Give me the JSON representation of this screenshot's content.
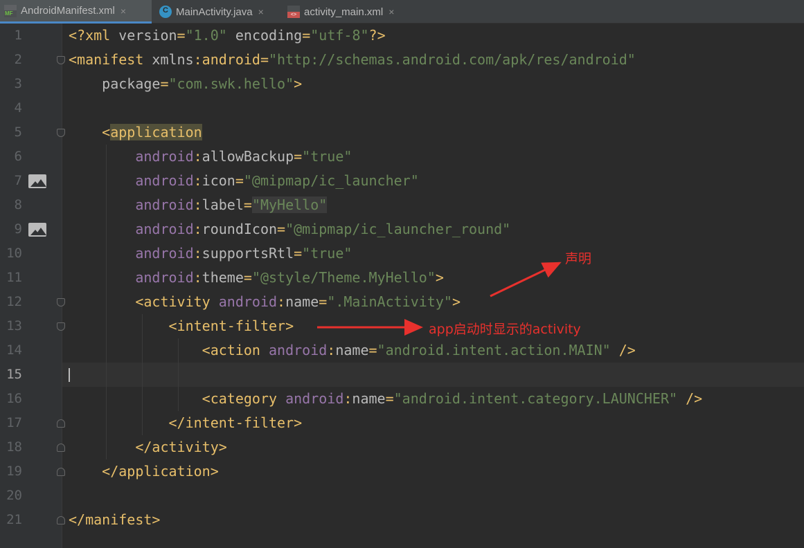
{
  "tabs": [
    {
      "label": "AndroidManifest.xml",
      "icon": "manifest-file-icon",
      "icon_text": "MF",
      "active": true
    },
    {
      "label": "MainActivity.java",
      "icon": "java-class-icon",
      "icon_text": "C",
      "active": false
    },
    {
      "label": "activity_main.xml",
      "icon": "layout-xml-icon",
      "icon_text": "<>",
      "active": false
    }
  ],
  "tab_close_glyph": "×",
  "editor": {
    "current_line": 15,
    "line_numbers": [
      "1",
      "2",
      "3",
      "4",
      "5",
      "6",
      "7",
      "8",
      "9",
      "10",
      "11",
      "12",
      "13",
      "14",
      "15",
      "16",
      "17",
      "18",
      "19",
      "20",
      "21"
    ],
    "lines": [
      "<?xml version=\"1.0\" encoding=\"utf-8\"?>",
      "<manifest xmlns:android=\"http://schemas.android.com/apk/res/android\"",
      "    package=\"com.swk.hello\">",
      "",
      "    <application",
      "        android:allowBackup=\"true\"",
      "        android:icon=\"@mipmap/ic_launcher\"",
      "        android:label=\"MyHello\"",
      "        android:roundIcon=\"@mipmap/ic_launcher_round\"",
      "        android:supportsRtl=\"true\"",
      "        android:theme=\"@style/Theme.MyHello\">",
      "        <activity android:name=\".MainActivity\">",
      "            <intent-filter>",
      "                <action android:name=\"android.intent.action.MAIN\" />",
      "",
      "                <category android:name=\"android.intent.category.LAUNCHER\" />",
      "            </intent-filter>",
      "        </activity>",
      "    </application>",
      "",
      "</manifest>"
    ]
  },
  "gutter_icons": [
    {
      "line": 7,
      "icon": "image-icon"
    },
    {
      "line": 9,
      "icon": "image-icon"
    }
  ],
  "annotations": {
    "declare_label": "声明",
    "launch_label": "app启动时显示的activity",
    "color": "#e8312d"
  },
  "colors": {
    "background": "#2b2b2b",
    "tag": "#e8bf6a",
    "attribute": "#bababa",
    "string": "#6a8759",
    "namespace": "#9876aa"
  }
}
